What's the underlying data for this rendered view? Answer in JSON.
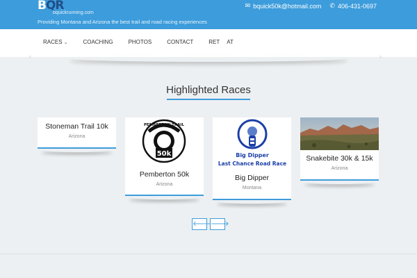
{
  "header": {
    "logo_mark_b": "B",
    "logo_mark_q": "QR",
    "logo_sub": "bquickrunning.com",
    "tagline": "Providing Montana and Arizona the best trail and road racing experiences",
    "email": "bquick50k@hotmail.com",
    "phone": "406-431-0697",
    "email_icon": "envelope-icon",
    "phone_icon": "phone-icon",
    "color_primary": "#3d9cdb"
  },
  "nav": {
    "items": [
      {
        "label": "RACES",
        "has_dropdown": true
      },
      {
        "label": "COACHING"
      },
      {
        "label": "PHOTOS"
      },
      {
        "label": "CONTACT"
      },
      {
        "label": "RET"
      },
      {
        "label": "AT"
      }
    ]
  },
  "section": {
    "title": "Highlighted Races"
  },
  "cards": [
    {
      "name": "Stoneman Trail 10k",
      "location": "Arizona"
    },
    {
      "name": "Pemberton 50k",
      "location": "Arizona",
      "image_text": [
        "PEMBERTON TRAIL",
        "50k"
      ]
    },
    {
      "name": "Big Dipper",
      "location": "Montana",
      "image_text": [
        "Big Dipper",
        "Last Chance Road Race"
      ]
    },
    {
      "name": "Snakebite 30k & 15k",
      "location": "Arizona"
    }
  ],
  "controls": {
    "prev_icon": "arrow-left-icon",
    "next_icon": "arrow-right-icon"
  }
}
